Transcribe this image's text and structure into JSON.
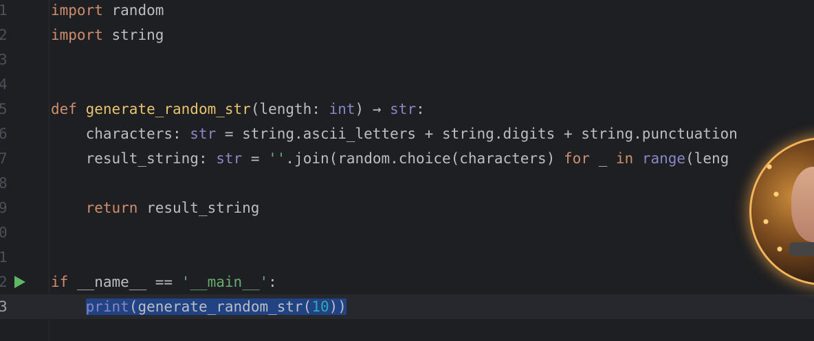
{
  "editor": {
    "language": "python",
    "lines": [
      {
        "num": "1"
      },
      {
        "num": "2"
      },
      {
        "num": "3"
      },
      {
        "num": "4"
      },
      {
        "num": "5"
      },
      {
        "num": "6"
      },
      {
        "num": "7"
      },
      {
        "num": "8"
      },
      {
        "num": "9"
      },
      {
        "num": "0"
      },
      {
        "num": "1"
      },
      {
        "num": "2"
      },
      {
        "num": "3"
      }
    ],
    "tokens": {
      "import": "import",
      "random": "random",
      "string": "string",
      "def": "def",
      "func_name": "generate_random_str",
      "param_open": "(length: ",
      "int": "int",
      "param_close": ") ",
      "arrow": "→",
      "str": "str",
      "colon": ":",
      "characters_decl": "characters: ",
      "chars_rhs": " = string.ascii_letters + string.digits + string.punctuation",
      "result_decl": "result_string: ",
      "eq": " = ",
      "empty_str": "''",
      "join_call": ".join(random.choice(characters) ",
      "for": "for",
      "underscore": " _ ",
      "in": "in",
      "range": "range",
      "range_arg": "(leng",
      "return": "return",
      "result_string": " result_string",
      "if": "if",
      "name_cmp": " __name__ ",
      "eqeq": "==",
      "main_str": "'__main__'",
      "print": "print",
      "print_open": "(",
      "gen_call": "generate_random_str",
      "paren_open": "(",
      "ten": "10",
      "paren_close": "))"
    },
    "run_icon_color": "#5fb865",
    "current_line": "3"
  }
}
